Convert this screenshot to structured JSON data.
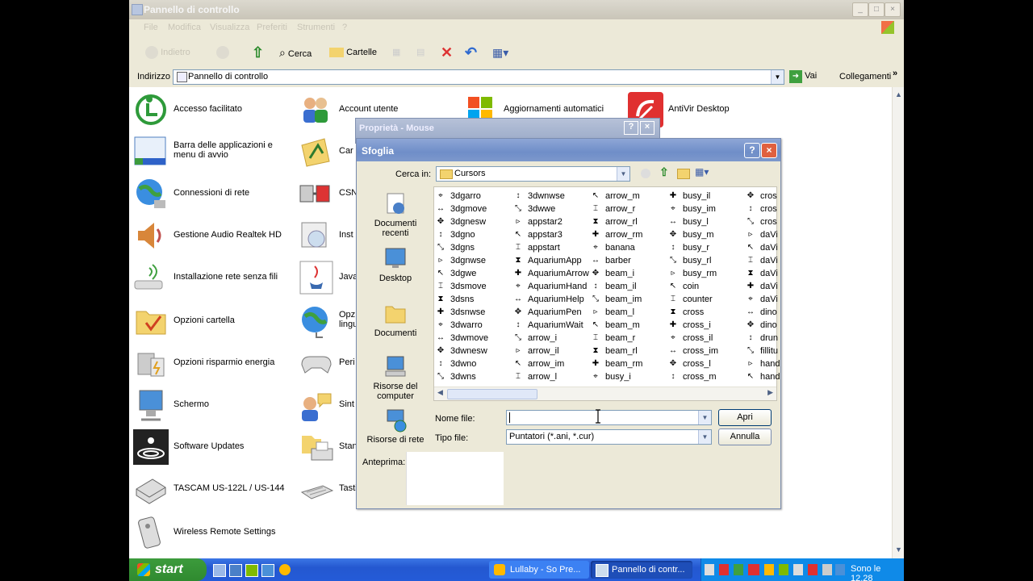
{
  "window": {
    "title": "Pannello di controllo",
    "menu": [
      "File",
      "Modifica",
      "Visualizza",
      "Preferiti",
      "Strumenti",
      "?"
    ]
  },
  "toolbar": {
    "back_label": "Indietro",
    "search_label": "Cerca",
    "folders_label": "Cartelle"
  },
  "address": {
    "label": "Indirizzo",
    "value": "Pannello di controllo",
    "go_label": "Vai",
    "links_label": "Collegamenti"
  },
  "control_panel": {
    "col1": [
      {
        "label": "Accesso facilitato",
        "icon": "accessibility-icon"
      },
      {
        "label": "Barra delle applicazioni e menu di avvio",
        "icon": "taskbar-icon"
      },
      {
        "label": "Connessioni di rete",
        "icon": "network-icon"
      },
      {
        "label": "Gestione Audio Realtek HD",
        "icon": "speaker-icon"
      },
      {
        "label": "Installazione rete senza fili",
        "icon": "wireless-icon"
      },
      {
        "label": "Opzioni cartella",
        "icon": "folder-options-icon"
      },
      {
        "label": "Opzioni risparmio energia",
        "icon": "power-icon"
      },
      {
        "label": "Schermo",
        "icon": "display-icon"
      },
      {
        "label": "Software Updates",
        "icon": "updates-icon"
      },
      {
        "label": "TASCAM US-122L / US-144",
        "icon": "audio-device-icon"
      },
      {
        "label": "Wireless Remote Settings",
        "icon": "remote-icon"
      }
    ],
    "col2": [
      {
        "label": "Account utente",
        "icon": "users-icon"
      },
      {
        "label": "Car",
        "icon": "fonts-icon"
      },
      {
        "label": "CSN",
        "icon": "csnet-icon"
      },
      {
        "label": "Inst",
        "icon": "install-icon"
      },
      {
        "label": "Java",
        "icon": "java-icon"
      },
      {
        "label": "Opz",
        "sub": "lingu",
        "icon": "regional-icon"
      },
      {
        "label": "Peri",
        "icon": "gamepad-icon"
      },
      {
        "label": "Sint",
        "icon": "speech-icon"
      },
      {
        "label": "Stan",
        "icon": "printer-icon"
      },
      {
        "label": "Tasti",
        "icon": "keyboard-icon"
      }
    ],
    "col3": [
      {
        "label": "Aggiornamenti automatici",
        "icon": "windows-update-icon"
      }
    ],
    "col4": [
      {
        "label": "AntiVir Desktop",
        "icon": "antivir-icon"
      }
    ]
  },
  "bg_dialog": {
    "title": "Proprietà - Mouse"
  },
  "dialog": {
    "title": "Sfoglia",
    "look_in_label": "Cerca in:",
    "look_in_value": "Cursors",
    "places": [
      "Documenti recenti",
      "Desktop",
      "Documenti",
      "Risorse del computer",
      "Risorse di rete"
    ],
    "columns": [
      [
        "3dgarro",
        "3dgmove",
        "3dgnesw",
        "3dgno",
        "3dgns",
        "3dgnwse",
        "3dgwe",
        "3dsmove",
        "3dsns",
        "3dsnwse",
        "3dwarro",
        "3dwmove",
        "3dwnesw",
        "3dwno",
        "3dwns"
      ],
      [
        "3dwnwse",
        "3dwwe",
        "appstar2",
        "appstar3",
        "appstart",
        "AquariumApp",
        "AquariumArrow",
        "AquariumHand",
        "AquariumHelp",
        "AquariumPen",
        "AquariumWait",
        "arrow_i",
        "arrow_il",
        "arrow_im",
        "arrow_l"
      ],
      [
        "arrow_m",
        "arrow_r",
        "arrow_rl",
        "arrow_rm",
        "banana",
        "barber",
        "beam_i",
        "beam_il",
        "beam_im",
        "beam_l",
        "beam_m",
        "beam_r",
        "beam_rl",
        "beam_rm",
        "busy_i"
      ],
      [
        "busy_il",
        "busy_im",
        "busy_l",
        "busy_m",
        "busy_r",
        "busy_rl",
        "busy_rm",
        "coin",
        "counter",
        "cross",
        "cross_i",
        "cross_il",
        "cross_im",
        "cross_l",
        "cross_m"
      ],
      [
        "cros",
        "cros",
        "cros",
        "daVi",
        "daVi",
        "daVi",
        "daVi",
        "daVi",
        "daVi",
        "dino",
        "dino",
        "drun",
        "fillitu",
        "hand",
        "hand"
      ]
    ],
    "filename_label": "Nome file:",
    "filename_value": "",
    "filetype_label": "Tipo file:",
    "filetype_value": "Puntatori (*.ani, *.cur)",
    "open_label": "Apri",
    "cancel_label": "Annulla",
    "preview_label": "Anteprima:"
  },
  "taskbar": {
    "start_label": "start",
    "tasks": [
      "Lullaby - So Pre...",
      "Pannello di contr..."
    ],
    "clock": "Sono le 12.28"
  }
}
